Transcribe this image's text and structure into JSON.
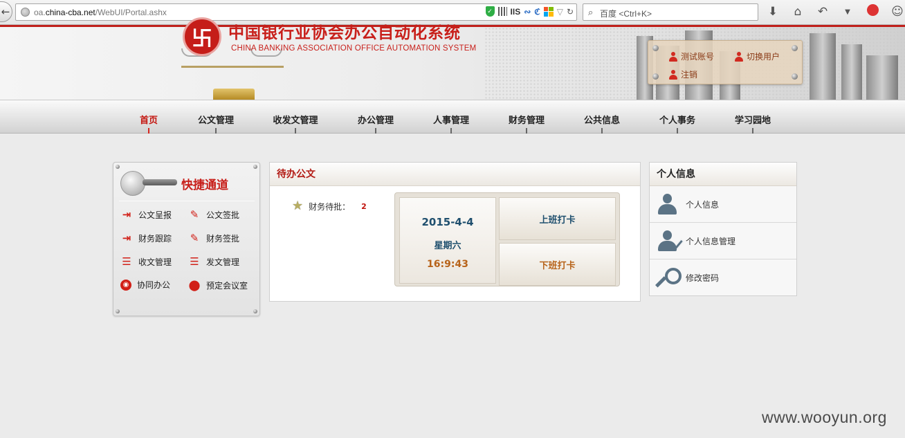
{
  "browser": {
    "url_prefix": "oa.",
    "url_domain": "china-cba.net",
    "url_path": "/WebUI/Portal.ashx",
    "iis_label": "IIS",
    "search_placeholder": "百度 <Ctrl+K>"
  },
  "header": {
    "title_cn": "中国银行业协会办公自动化系统",
    "title_en": "CHINA BANKING ASSOCIATION  OFFICE AUTOMATION SYSTEM",
    "user_links": {
      "account": "测试账号",
      "switch_user": "切换用户",
      "logout": "注销"
    }
  },
  "nav": {
    "items": [
      {
        "label": "首页",
        "active": true
      },
      {
        "label": "公文管理"
      },
      {
        "label": "收发文管理"
      },
      {
        "label": "办公管理"
      },
      {
        "label": "人事管理"
      },
      {
        "label": "财务管理"
      },
      {
        "label": "公共信息"
      },
      {
        "label": "个人事务"
      },
      {
        "label": "学习园地"
      }
    ]
  },
  "quick_access": {
    "title": "快捷通道",
    "items": [
      {
        "label": "公文呈报",
        "icon": "enter-icon"
      },
      {
        "label": "公文签批",
        "icon": "pencil-icon"
      },
      {
        "label": "财务跟踪",
        "icon": "enter-icon"
      },
      {
        "label": "财务签批",
        "icon": "pencil-icon"
      },
      {
        "label": "收文管理",
        "icon": "list-in-icon"
      },
      {
        "label": "发文管理",
        "icon": "list-out-icon"
      },
      {
        "label": "协同办公",
        "icon": "globe-icon"
      },
      {
        "label": "预定会议室",
        "icon": "location-pin-icon"
      }
    ]
  },
  "pending_docs": {
    "title": "待办公文",
    "item_label": "财务待批：",
    "item_count": "2",
    "date": "2015-4-4",
    "weekday": "星期六",
    "time": "16:9:43",
    "clock_in": "上班打卡",
    "clock_out": "下班打卡"
  },
  "personal_info": {
    "title": "个人信息",
    "items": [
      {
        "label": "个人信息",
        "icon": "user-icon"
      },
      {
        "label": "个人信息管理",
        "icon": "user-edit-icon"
      },
      {
        "label": "修改密码",
        "icon": "key-icon"
      }
    ]
  },
  "watermark": "www.wooyun.org",
  "colors": {
    "brand_red": "#c81f1a",
    "nav_active": "#c3140e",
    "clock_blue": "#1f4f6e",
    "clock_orange": "#b7631a"
  }
}
